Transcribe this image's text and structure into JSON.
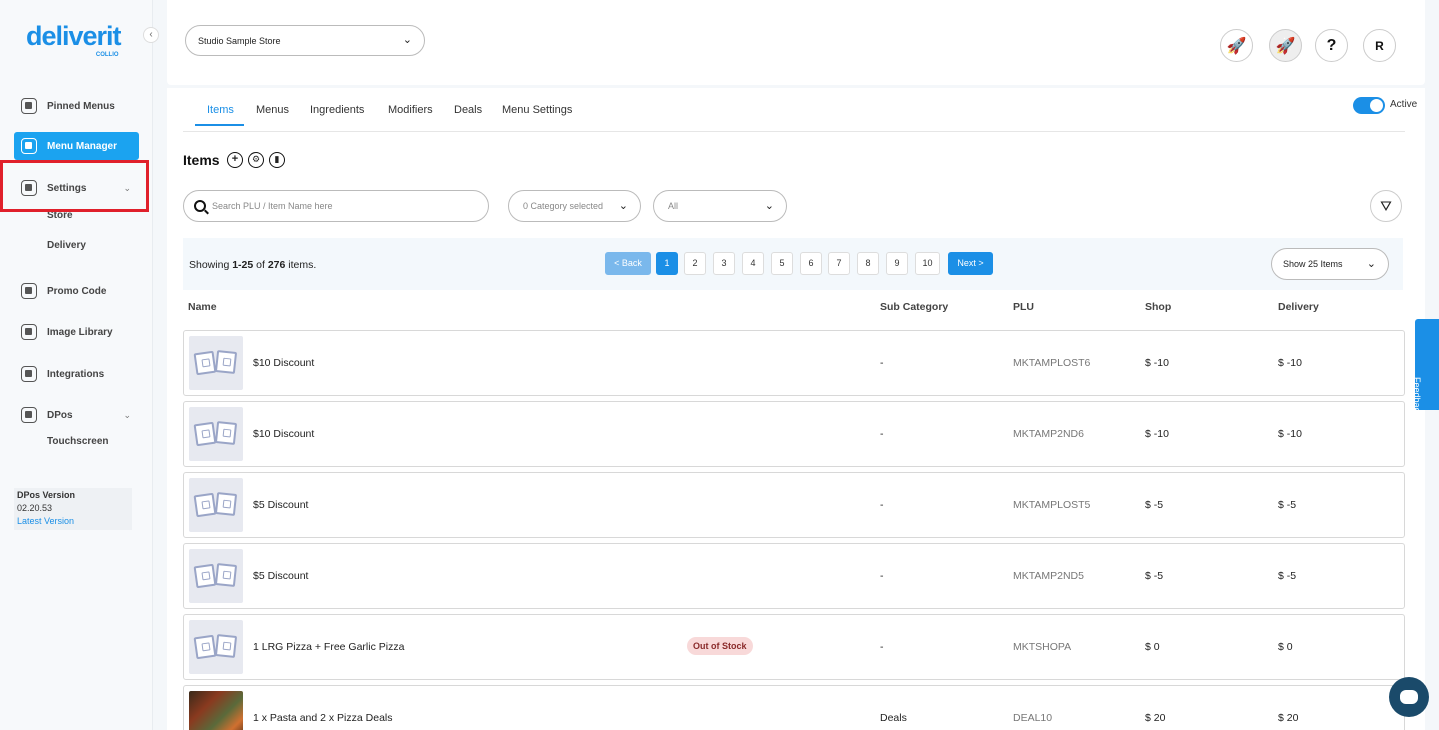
{
  "brand": {
    "name": "deliverit",
    "sub": "COLLIO"
  },
  "sidebar": {
    "items": [
      {
        "label": "Pinned Menus"
      },
      {
        "label": "Menu Manager"
      },
      {
        "label": "Settings"
      },
      {
        "label": "Promo Code"
      },
      {
        "label": "Image Library"
      },
      {
        "label": "Integrations"
      },
      {
        "label": "DPos"
      }
    ],
    "settings_sub": [
      "Store",
      "Delivery"
    ],
    "dpos_sub": [
      "Touchscreen"
    ],
    "version_title": "DPos Version",
    "version_number": "02.20.53",
    "version_link": "Latest Version"
  },
  "topbar": {
    "store": "Studio Sample Store",
    "avatar": "R",
    "help": "?"
  },
  "tabs": [
    "Items",
    "Menus",
    "Ingredients",
    "Modifiers",
    "Deals",
    "Menu Settings"
  ],
  "active_toggle_label": "Active",
  "items_title": "Items",
  "search": {
    "placeholder": "Search PLU / Item Name here"
  },
  "category_filter": "0 Category selected",
  "status_filter": "All",
  "pager": {
    "showing_prefix": "Showing ",
    "range": "1-25",
    "of": " of ",
    "total": "276",
    "suffix": " items.",
    "back": "< Back",
    "pages": [
      "1",
      "2",
      "3",
      "4",
      "5",
      "6",
      "7",
      "8",
      "9",
      "10"
    ],
    "next": "Next >",
    "page_size": "Show 25 Items"
  },
  "columns": [
    "Name",
    "Sub Category",
    "PLU",
    "Shop",
    "Delivery"
  ],
  "rows": [
    {
      "name": "$10 Discount",
      "sub": "-",
      "plu": "MKTAMPLOST6",
      "shop": "$ -10",
      "delivery": "$ -10"
    },
    {
      "name": "$10 Discount",
      "sub": "-",
      "plu": "MKTAMP2ND6",
      "shop": "$ -10",
      "delivery": "$ -10"
    },
    {
      "name": "$5 Discount",
      "sub": "-",
      "plu": "MKTAMPLOST5",
      "shop": "$ -5",
      "delivery": "$ -5"
    },
    {
      "name": "$5 Discount",
      "sub": "-",
      "plu": "MKTAMP2ND5",
      "shop": "$ -5",
      "delivery": "$ -5"
    },
    {
      "name": "1 LRG Pizza + Free Garlic Pizza",
      "badge": "Out of Stock",
      "sub": "-",
      "plu": "MKTSHOPA",
      "shop": "$ 0",
      "delivery": "$ 0"
    },
    {
      "name": "1 x Pasta and 2 x Pizza Deals",
      "sub": "Deals",
      "plu": "DEAL10",
      "shop": "$ 20",
      "delivery": "$ 20"
    }
  ],
  "feedback_label": "Feedback",
  "colors": {
    "accent": "#1b8fe6",
    "active_nav": "#1ba3f0",
    "highlight": "#e0202b",
    "badge_bg": "#f8d9d9"
  }
}
